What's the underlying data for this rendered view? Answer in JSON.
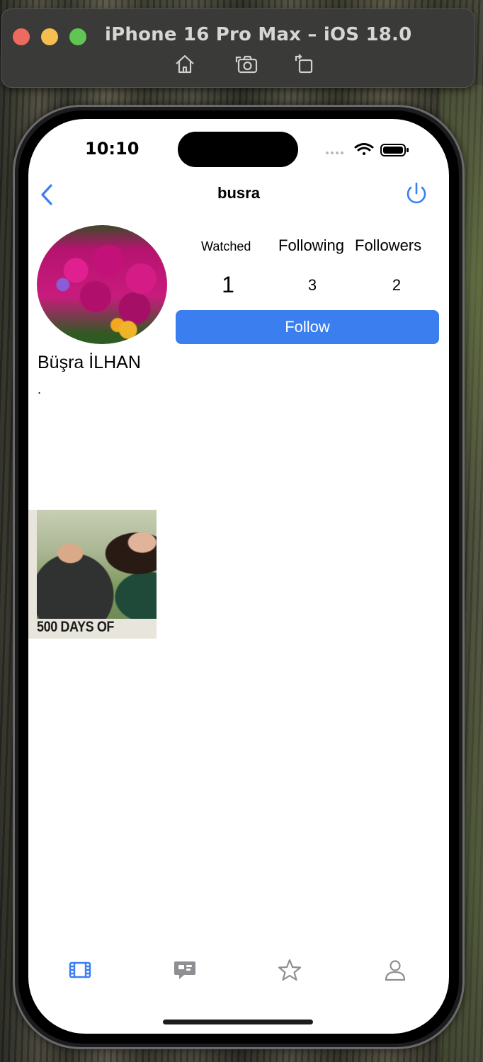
{
  "simulator": {
    "title": "iPhone 16 Pro Max – iOS 18.0",
    "buttons": [
      "home-icon",
      "screenshot-icon",
      "rotate-icon"
    ]
  },
  "status_bar": {
    "time": "10:10",
    "icons": [
      "cellular-signal-icon",
      "wifi-icon",
      "battery-icon"
    ]
  },
  "nav": {
    "back_icon": "chevron-left-icon",
    "title": "busra",
    "right_icon": "power-icon"
  },
  "profile": {
    "full_name": "Büşra İLHAN",
    "bio": ".",
    "stats": {
      "watched_label": "Watched",
      "watched_value": "1",
      "following_label": "Following",
      "following_value": "3",
      "followers_label": "Followers",
      "followers_value": "2"
    },
    "follow_label": "Follow"
  },
  "movies": [
    {
      "poster_title": "500 DAYS OF"
    }
  ],
  "tabbar": {
    "items": [
      "film-icon",
      "chat-icon",
      "star-icon",
      "person-icon"
    ],
    "active_color": "#3a7ef0",
    "inactive_color": "#8e8e93"
  },
  "colors": {
    "accent": "#3a7ef0"
  }
}
